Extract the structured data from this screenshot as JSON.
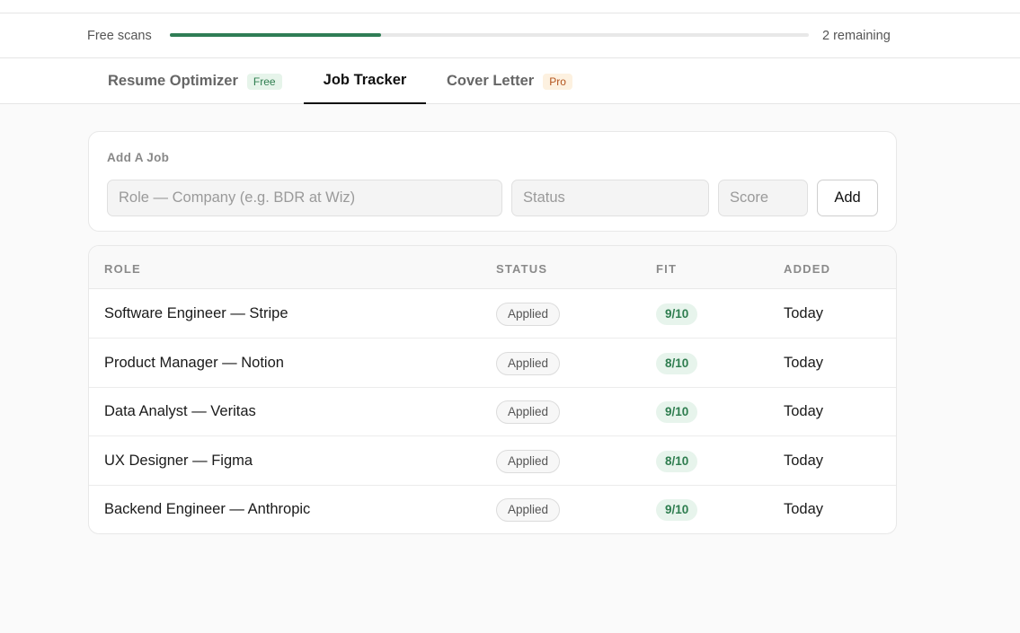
{
  "usage": {
    "label": "Free scans",
    "remaining": "2 remaining",
    "progress_fraction": 0.33,
    "accent": "#2f7d55"
  },
  "tabs": [
    {
      "label": "Resume Optimizer",
      "badge": "Free"
    },
    {
      "label": "Job Tracker",
      "badge": null,
      "active": true
    },
    {
      "label": "Cover Letter",
      "badge": "Pro"
    }
  ],
  "add_job": {
    "title": "Add A Job",
    "role_placeholder": "Role — Company (e.g. BDR at Wiz)",
    "status_placeholder": "Status",
    "score_placeholder": "Score",
    "add_label": "Add"
  },
  "table": {
    "headers": {
      "role": "ROLE",
      "status": "STATUS",
      "fit": "FIT",
      "added": "ADDED"
    },
    "rows": [
      {
        "role": "Software Engineer — Stripe",
        "status": "Applied",
        "fit": "9/10",
        "added": "Today"
      },
      {
        "role": "Product Manager — Notion",
        "status": "Applied",
        "fit": "8/10",
        "added": "Today"
      },
      {
        "role": "Data Analyst — Veritas",
        "status": "Applied",
        "fit": "9/10",
        "added": "Today"
      },
      {
        "role": "UX Designer — Figma",
        "status": "Applied",
        "fit": "8/10",
        "added": "Today"
      },
      {
        "role": "Backend Engineer — Anthropic",
        "status": "Applied",
        "fit": "9/10",
        "added": "Today"
      }
    ]
  }
}
